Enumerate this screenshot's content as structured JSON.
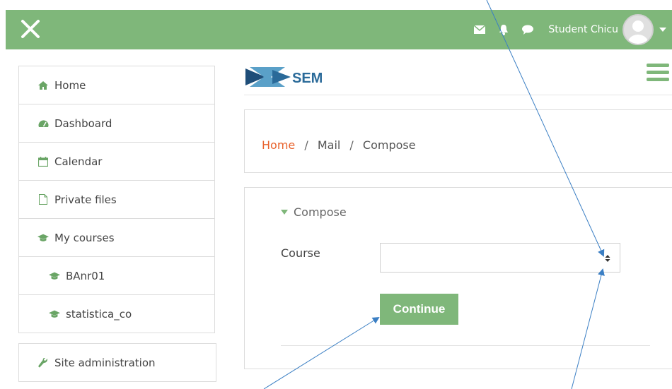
{
  "topbar": {
    "user_name": "Student Chicu",
    "icons": [
      "close-icon",
      "envelope-icon",
      "bell-icon",
      "chat-bubble-icon",
      "avatar",
      "caret-down-icon"
    ]
  },
  "sidebar": {
    "items": [
      {
        "label": "Home",
        "icon": "home-icon"
      },
      {
        "label": "Dashboard",
        "icon": "dashboard-icon"
      },
      {
        "label": "Calendar",
        "icon": "calendar-icon"
      },
      {
        "label": "Private files",
        "icon": "file-icon"
      },
      {
        "label": "My courses",
        "icon": "graduation-cap-icon"
      },
      {
        "label": "BAnr01",
        "icon": "graduation-cap-icon"
      },
      {
        "label": "statistica_co",
        "icon": "graduation-cap-icon"
      }
    ],
    "admin": {
      "label": "Site administration",
      "icon": "wrench-icon"
    }
  },
  "breadcrumb": {
    "home": "Home",
    "separator": "/",
    "mail": "Mail",
    "compose": "Compose"
  },
  "form": {
    "section_title": "Compose",
    "course_label": "Course",
    "course_value": "",
    "continue_label": "Continue"
  },
  "colors": {
    "brand_green": "#7fb77a",
    "link_orange": "#e8622c",
    "annotation_blue": "#3b7fc4"
  }
}
